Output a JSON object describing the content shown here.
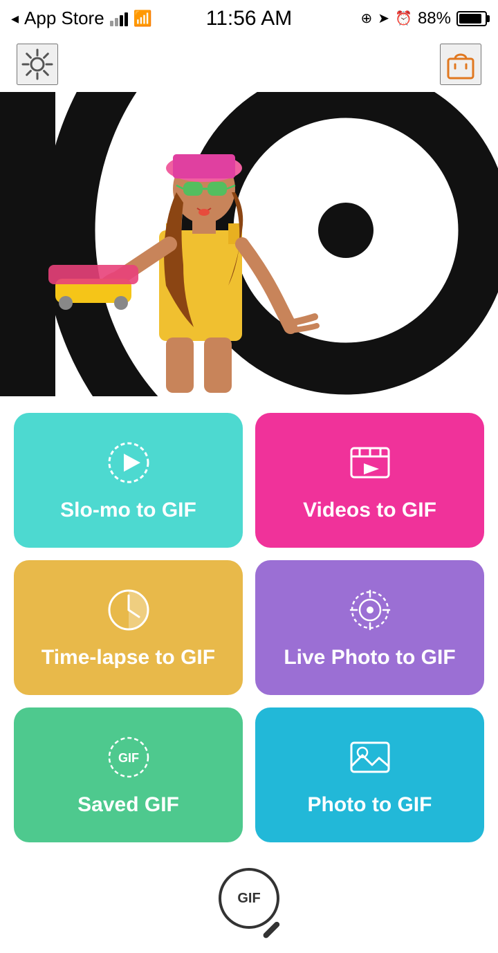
{
  "statusBar": {
    "carrier": "App Store",
    "time": "11:56 AM",
    "battery": "88%"
  },
  "header": {
    "settingsLabel": "Settings",
    "shopLabel": "Shop"
  },
  "hero": {
    "alt": "Stylish woman with skateboard and sunglasses on spiral background"
  },
  "grid": {
    "buttons": [
      {
        "id": "slo-mo",
        "label": "Slo-mo to GIF",
        "colorClass": "btn-teal",
        "iconType": "play-circle-dashed"
      },
      {
        "id": "videos",
        "label": "Videos to GIF",
        "colorClass": "btn-pink",
        "iconType": "film-play"
      },
      {
        "id": "timelapse",
        "label": "Time-lapse to GIF",
        "colorClass": "btn-gold",
        "iconType": "clock-half"
      },
      {
        "id": "livephoto",
        "label": "Live Photo to GIF",
        "colorClass": "btn-purple",
        "iconType": "target-dashed"
      },
      {
        "id": "savedgif",
        "label": "Saved GIF",
        "colorClass": "btn-green",
        "iconType": "gif-dashed"
      },
      {
        "id": "photogif",
        "label": "Photo to GIF",
        "colorClass": "btn-cyan",
        "iconType": "image"
      }
    ]
  },
  "bottomSearch": {
    "label": "GIF"
  }
}
